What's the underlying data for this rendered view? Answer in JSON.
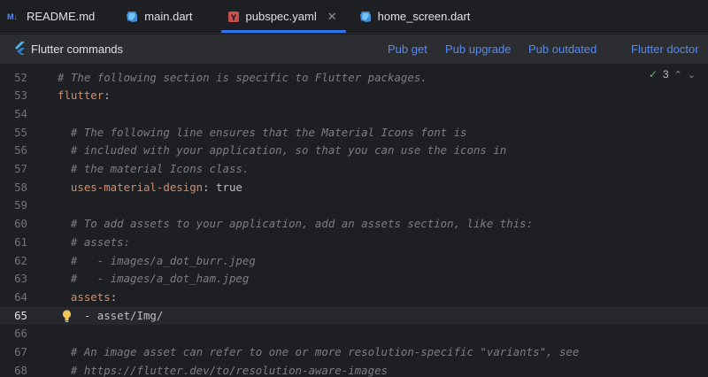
{
  "tabs": [
    {
      "label": "README.md",
      "icon": "markdown-icon",
      "active": false
    },
    {
      "label": "main.dart",
      "icon": "dart-icon",
      "active": false
    },
    {
      "label": "pubspec.yaml",
      "icon": "yaml-icon",
      "active": true
    },
    {
      "label": "home_screen.dart",
      "icon": "dart-icon",
      "active": false
    }
  ],
  "toolbar": {
    "title": "Flutter commands",
    "pub_get": "Pub get",
    "pub_upgrade": "Pub upgrade",
    "pub_outdated": "Pub outdated",
    "flutter_doctor": "Flutter doctor"
  },
  "inspection": {
    "count": "3"
  },
  "editor": {
    "current_line": "65",
    "lines": [
      {
        "num": "52",
        "parts": [
          {
            "t": "comment",
            "v": "# The following section is specific to Flutter packages."
          }
        ]
      },
      {
        "num": "53",
        "parts": [
          {
            "t": "key",
            "v": "flutter"
          },
          {
            "t": "plain",
            "v": ":"
          }
        ]
      },
      {
        "num": "54",
        "parts": []
      },
      {
        "num": "55",
        "parts": [
          {
            "t": "comment",
            "v": "  # The following line ensures that the Material Icons font is"
          }
        ]
      },
      {
        "num": "56",
        "parts": [
          {
            "t": "comment",
            "v": "  # included with your application, so that you can use the icons in"
          }
        ]
      },
      {
        "num": "57",
        "parts": [
          {
            "t": "comment",
            "v": "  # the material Icons class."
          }
        ]
      },
      {
        "num": "58",
        "parts": [
          {
            "t": "key",
            "v": "  uses-material-design"
          },
          {
            "t": "plain",
            "v": ": true"
          }
        ]
      },
      {
        "num": "59",
        "parts": []
      },
      {
        "num": "60",
        "parts": [
          {
            "t": "comment",
            "v": "  # To add assets to your application, add an assets section, like this:"
          }
        ]
      },
      {
        "num": "61",
        "parts": [
          {
            "t": "comment",
            "v": "  # assets:"
          }
        ]
      },
      {
        "num": "62",
        "parts": [
          {
            "t": "comment",
            "v": "  #   - images/a_dot_burr.jpeg"
          }
        ]
      },
      {
        "num": "63",
        "parts": [
          {
            "t": "comment",
            "v": "  #   - images/a_dot_ham.jpeg"
          }
        ]
      },
      {
        "num": "64",
        "parts": [
          {
            "t": "key",
            "v": "  assets"
          },
          {
            "t": "plain",
            "v": ":"
          }
        ]
      },
      {
        "num": "65",
        "parts": [
          {
            "t": "plain",
            "v": "    - asset/Img/"
          }
        ]
      },
      {
        "num": "66",
        "parts": []
      },
      {
        "num": "67",
        "parts": [
          {
            "t": "comment",
            "v": "  # An image asset can refer to one or more resolution-specific \"variants\", see"
          }
        ]
      },
      {
        "num": "68",
        "parts": [
          {
            "t": "comment",
            "v": "  # https://flutter.dev/to/resolution-aware-images"
          }
        ]
      }
    ]
  }
}
